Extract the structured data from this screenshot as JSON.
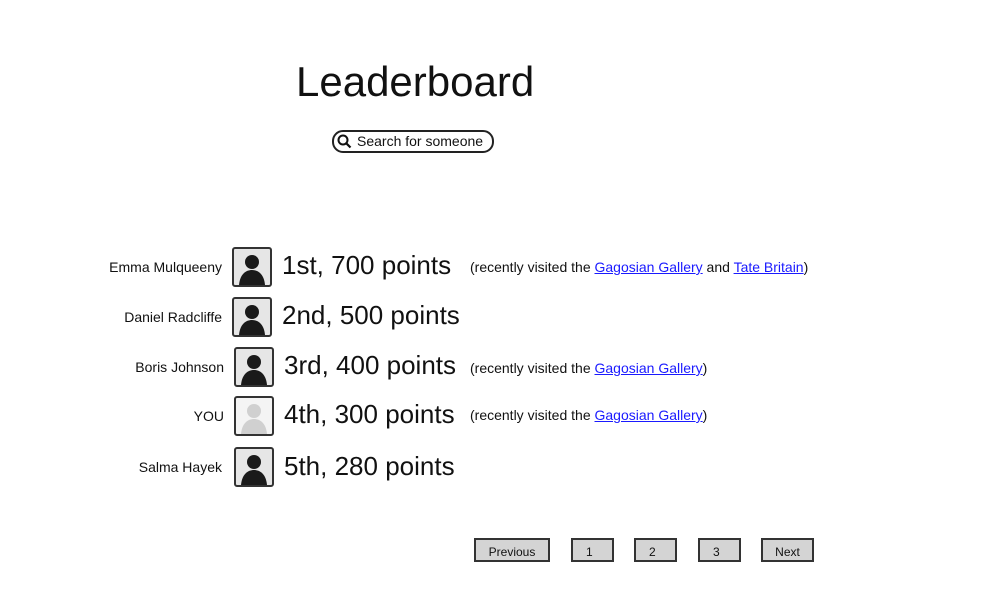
{
  "header": {
    "title": "Leaderboard"
  },
  "search": {
    "placeholder": "Search for someone"
  },
  "entries": [
    {
      "name": "Emma Mulqueeny",
      "rank": "1st, 700 points",
      "avatar": "dark",
      "visit": {
        "prefix": "(recently visited the ",
        "link1": "Gagosian Gallery",
        "mid": " and ",
        "link2": "Tate Britain",
        "suffix": ")"
      }
    },
    {
      "name": "Daniel Radcliffe",
      "rank": "2nd, 500 points",
      "avatar": "dark"
    },
    {
      "name": "Boris Johnson",
      "rank": "3rd, 400 points",
      "avatar": "dark",
      "visit": {
        "prefix": "(recently visited the ",
        "link1": "Gagosian Gallery",
        "suffix": ")"
      }
    },
    {
      "name": "YOU",
      "rank": "4th, 300 points",
      "avatar": "light",
      "visit": {
        "prefix": "(recently visited the ",
        "link1": "Gagosian Gallery",
        "suffix": ")"
      }
    },
    {
      "name": "Salma Hayek",
      "rank": "5th, 280 points",
      "avatar": "dark"
    }
  ],
  "pagination": {
    "previous": "Previous",
    "pages": [
      "1",
      "2",
      "3"
    ],
    "next": "Next"
  }
}
